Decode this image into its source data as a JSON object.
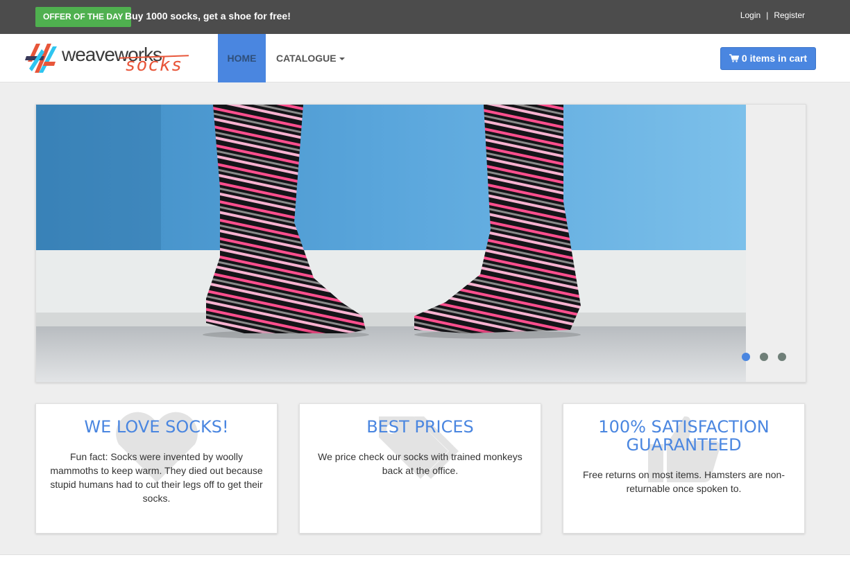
{
  "topbar": {
    "offer_badge": "OFFER OF THE DAY",
    "offer_text": "Buy 1000 socks, get a shoe for free!",
    "login": "Login",
    "separator": "|",
    "register": "Register"
  },
  "navbar": {
    "logo_main_1": "weave",
    "logo_main_2": "works",
    "logo_sub": "socks",
    "home": "HOME",
    "catalogue": "CATALOGUE",
    "cart": "0 items in cart"
  },
  "carousel": {
    "slide_count": 3,
    "active_index": 0
  },
  "features": [
    {
      "title": "WE LOVE SOCKS!",
      "text": "Fun fact: Socks were invented by woolly mammoths to keep warm. They died out because stupid humans had to cut their legs off to get their socks.",
      "icon": "heart-icon"
    },
    {
      "title": "BEST PRICES",
      "text": "We price check our socks with trained monkeys back at the office.",
      "icon": "tags-icon"
    },
    {
      "title": "100% SATISFACTION GUARANTEED",
      "text": "Free returns on most items. Hamsters are non-returnable once spoken to.",
      "icon": "thumbs-up-icon"
    }
  ],
  "colors": {
    "topbar_bg": "#4c4c4c",
    "offer_green": "#4fb04f",
    "accent_blue": "#4a86e0",
    "logo_red": "#e8563a"
  }
}
